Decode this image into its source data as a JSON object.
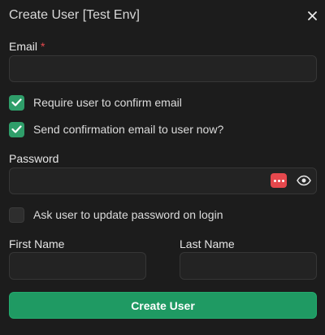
{
  "dialog": {
    "title": "Create User [Test Env]"
  },
  "form": {
    "email": {
      "label": "Email",
      "required_marker": "*",
      "value": "",
      "placeholder": ""
    },
    "confirm_email": {
      "label": "Require user to confirm email",
      "checked": true
    },
    "send_confirmation": {
      "label": "Send confirmation email to user now?",
      "checked": true
    },
    "password": {
      "label": "Password",
      "value": "",
      "placeholder": ""
    },
    "update_password": {
      "label": "Ask user to update password on login",
      "checked": false
    },
    "first_name": {
      "label": "First Name",
      "value": "",
      "placeholder": ""
    },
    "last_name": {
      "label": "Last Name",
      "value": "",
      "placeholder": ""
    },
    "submit_label": "Create User"
  },
  "icons": {
    "close": "close-icon",
    "check": "check-icon",
    "password_manager": "password-manager-icon",
    "show_password": "eye-icon"
  },
  "colors": {
    "background": "#1c1c1c",
    "input_bg": "#232323",
    "accent": "#1f9a63",
    "checkbox_on": "#2f9e6a",
    "required": "#e5484d",
    "password_manager_badge": "#e5484d"
  }
}
